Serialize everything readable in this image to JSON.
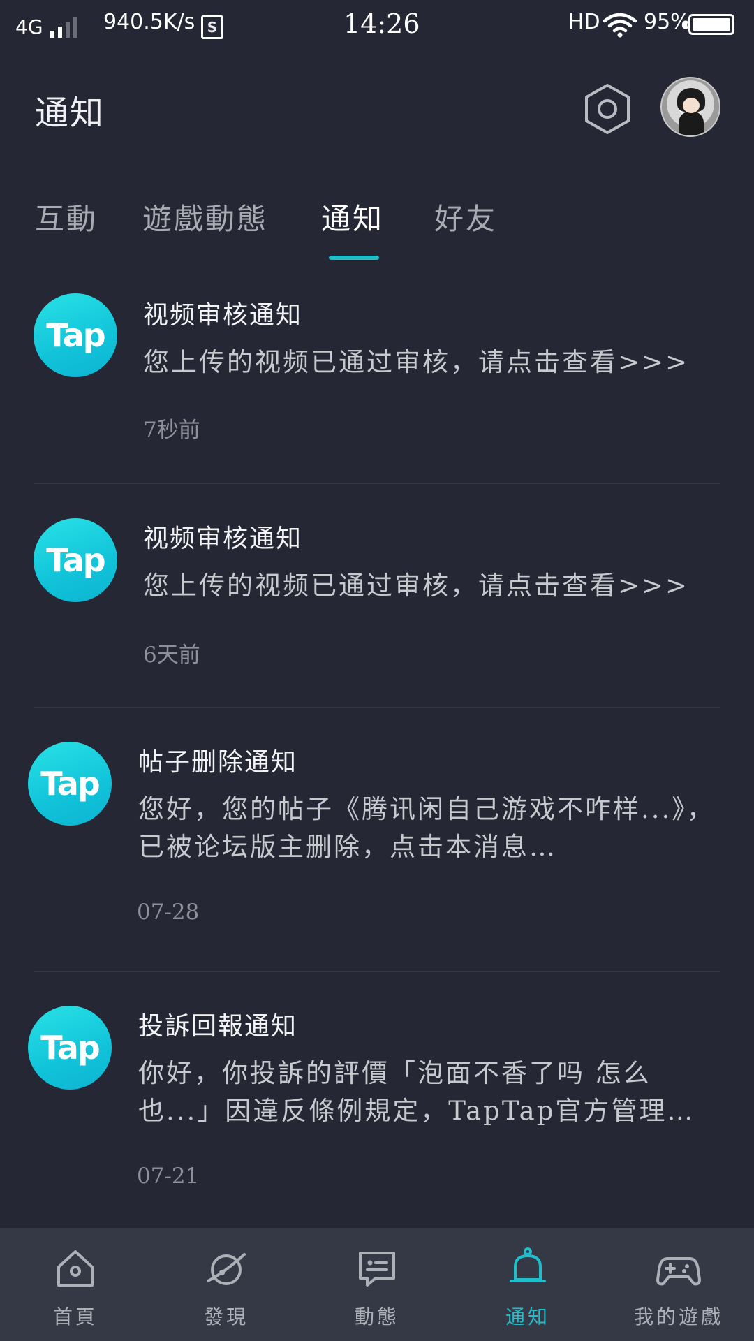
{
  "status_bar": {
    "network": "4G",
    "speed": "940.5K/s",
    "s_badge": "S",
    "time": "14:26",
    "hd": "HD",
    "battery": "95%",
    "battery_level": 0.95
  },
  "header": {
    "title": "通知"
  },
  "tabs": [
    {
      "label": "互動",
      "active": false
    },
    {
      "label": "遊戲動態",
      "active": false
    },
    {
      "label": "通知",
      "active": true
    },
    {
      "label": "好友",
      "active": false
    }
  ],
  "notifications": [
    {
      "logo": "Tap",
      "title": "视频审核通知",
      "body": "您上传的视频已通过审核，请点击查看>>>",
      "time": "7秒前"
    },
    {
      "logo": "Tap",
      "title": "视频审核通知",
      "body": "您上传的视频已通过审核，请点击查看>>>",
      "time": "6天前"
    },
    {
      "logo": "Tap",
      "title": "帖子删除通知",
      "body": "您好，您的帖子《腾讯闲自己游戏不咋样...》，已被论坛版主删除，点击本消息…",
      "time": "07-28"
    },
    {
      "logo": "Tap",
      "title": "投訴回報通知",
      "body": "你好，你投訴的評價「泡面不香了吗 怎么也...」因違反條例規定，TapTap官方管理…",
      "time": "07-21"
    }
  ],
  "bottom_nav": [
    {
      "label": "首頁",
      "icon": "home-icon",
      "active": false
    },
    {
      "label": "發現",
      "icon": "planet-icon",
      "active": false
    },
    {
      "label": "動態",
      "icon": "chat-icon",
      "active": false
    },
    {
      "label": "通知",
      "icon": "bell-icon",
      "active": true
    },
    {
      "label": "我的遊戲",
      "icon": "gamepad-icon",
      "active": false
    }
  ],
  "colors": {
    "background": "#252834",
    "accent": "#1fbecb",
    "nav_background": "#353946"
  }
}
